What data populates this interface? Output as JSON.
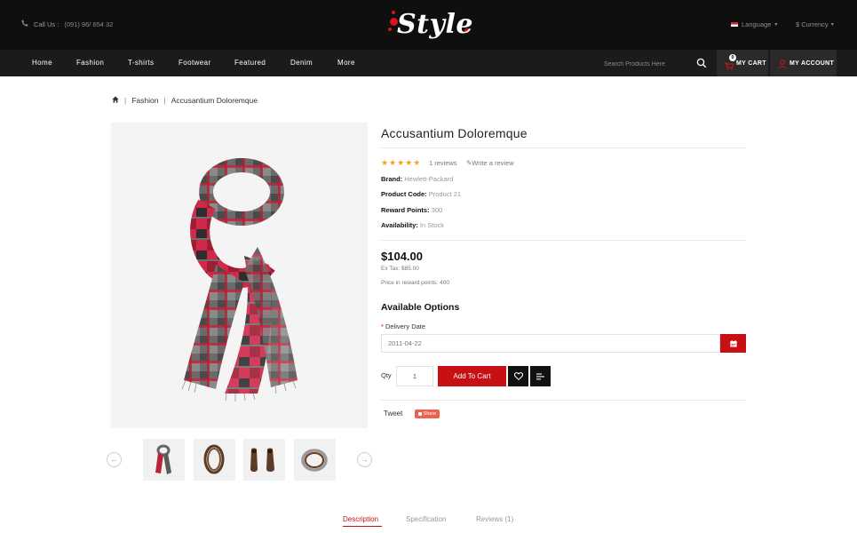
{
  "topbar": {
    "call_label": "Call Us :",
    "call_number": "(091) 96/ 654 32",
    "logo_text": "Style",
    "language_label": "Language",
    "currency_label": "$ Currency"
  },
  "nav": {
    "items": [
      "Home",
      "Fashion",
      "T-shirts",
      "Footwear",
      "Featured",
      "Denim",
      "More"
    ],
    "search_placeholder": "Search Products Here",
    "cart_label": "MY CART",
    "cart_count": "0",
    "account_label": "MY ACCOUNT"
  },
  "breadcrumb": {
    "items": [
      "Fashion",
      "Accusantium Doloremque"
    ]
  },
  "product": {
    "title": "Accusantium Doloremque",
    "rating_stars": "★★★★★",
    "rating": 5,
    "reviews": "1 reviews",
    "write_review": "Write a review",
    "specs": [
      {
        "label": "Brand:",
        "value": "Hewlett-Packard"
      },
      {
        "label": "Product Code:",
        "value": "Product 21"
      },
      {
        "label": "Reward Points:",
        "value": "300"
      },
      {
        "label": "Availability:",
        "value": "In Stock"
      }
    ],
    "price": "$104.00",
    "ex_tax": "Ex Tax: $85.00",
    "reward_price": "Price in reward points: 400",
    "options_heading": "Available Options",
    "delivery_label": "Delivery Date",
    "delivery_value": "2011-04-22",
    "qty_label": "Qty",
    "qty_value": "1",
    "add_to_cart": "Add To Cart",
    "tweet": "Tweet",
    "share": "Share"
  },
  "thumbnails": [
    "scarf",
    "leather-bracelet",
    "brown-boots",
    "ring"
  ],
  "tabs": [
    {
      "label": "Description",
      "active": true
    },
    {
      "label": "Specification",
      "active": false
    },
    {
      "label": "Reviews (1)",
      "active": false
    }
  ],
  "colors": {
    "accent": "#c81014",
    "topbar_bg": "#0f0f0f",
    "nav_bg": "#1b1b1b",
    "star": "#f3a21a"
  }
}
